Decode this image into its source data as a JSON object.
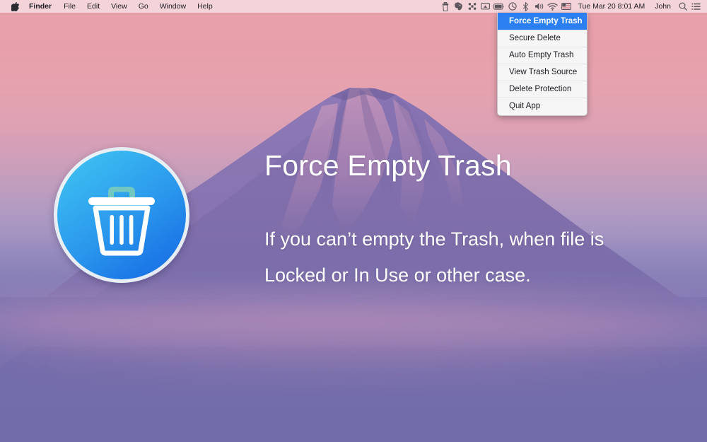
{
  "menubar": {
    "apple_icon": "apple-logo-icon",
    "left_items": [
      {
        "label": "Finder",
        "bold": true
      },
      {
        "label": "File",
        "bold": false
      },
      {
        "label": "Edit",
        "bold": false
      },
      {
        "label": "View",
        "bold": false
      },
      {
        "label": "Go",
        "bold": false
      },
      {
        "label": "Window",
        "bold": false
      },
      {
        "label": "Help",
        "bold": false
      }
    ],
    "status_icons": [
      "trash-icon",
      "evernote-icon",
      "dropbox-icon",
      "airplay-icon",
      "battery-icon",
      "time-machine-icon",
      "bluetooth-icon",
      "volume-icon",
      "wifi-icon",
      "input-source-flag-icon"
    ],
    "datetime": "Tue Mar 20  8:01 AM",
    "user": "John",
    "search_icon": "search-icon",
    "control-center_icon": "list-icon"
  },
  "menu": {
    "items": [
      {
        "label": "Force Empty Trash",
        "selected": true
      },
      {
        "label": "Secure Delete",
        "selected": false
      },
      {
        "label": "Auto Empty Trash",
        "selected": false
      },
      {
        "label": "View Trash Source",
        "selected": false
      },
      {
        "label": "Delete Protection",
        "selected": false
      },
      {
        "label": "Quit App",
        "selected": false
      }
    ],
    "highlight_color": "#2b7ff1",
    "background_color": "#f7f6f7"
  },
  "content": {
    "icon_name": "trash-can-app-icon",
    "headline": "Force Empty Trash",
    "subline": "If you can’t empty the Trash, when file is Locked or In Use or other case.",
    "icon_gradient_from": "#41c6f2",
    "icon_gradient_to": "#1b70e4",
    "icon_handle_color": "#6fc6c0"
  },
  "wallpaper": {
    "name": "mount-fuji-sunrise-wallpaper",
    "sky_top_color": "#e9a0aa",
    "sky_bottom_color": "#6864a3",
    "mountain_color": "#7a6ba8"
  }
}
